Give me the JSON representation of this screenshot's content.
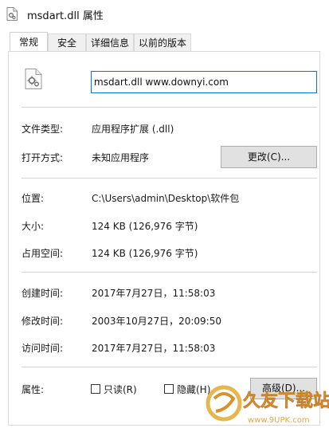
{
  "window": {
    "title": "msdart.dll 属性",
    "icon": "dll-file-icon"
  },
  "tabs": [
    {
      "label": "常规",
      "active": true
    },
    {
      "label": "安全",
      "active": false
    },
    {
      "label": "详细信息",
      "active": false
    },
    {
      "label": "以前的版本",
      "active": false
    }
  ],
  "general": {
    "file_name": "msdart.dll www.downyi.com",
    "file_type_label": "文件类型:",
    "file_type_value": "应用程序扩展 (.dll)",
    "opens_with_label": "打开方式:",
    "opens_with_value": "未知应用程序",
    "change_button": "更改(C)...",
    "location_label": "位置:",
    "location_value": "C:\\Users\\admin\\Desktop\\软件包",
    "size_label": "大小:",
    "size_value": "124 KB (126,976 字节)",
    "size_on_disk_label": "占用空间:",
    "size_on_disk_value": "124 KB (126,976 字节)",
    "created_label": "创建时间:",
    "created_value": "2017年7月27日，11:58:03",
    "modified_label": "修改时间:",
    "modified_value": "2003年10月27日，20:09:50",
    "accessed_label": "访问时间:",
    "accessed_value": "2017年7月27日，11:58:03",
    "attributes_label": "属性:",
    "readonly_label": "只读(R)",
    "hidden_label": "隐藏(H)",
    "advanced_button": "高级(D)..."
  },
  "watermark": {
    "brand": "久友下载站",
    "url": "www.9UPK.com"
  },
  "colors": {
    "focus_border": "#0078d7",
    "divider": "#d4d4d4",
    "button_bg": "#e1e1e1"
  }
}
